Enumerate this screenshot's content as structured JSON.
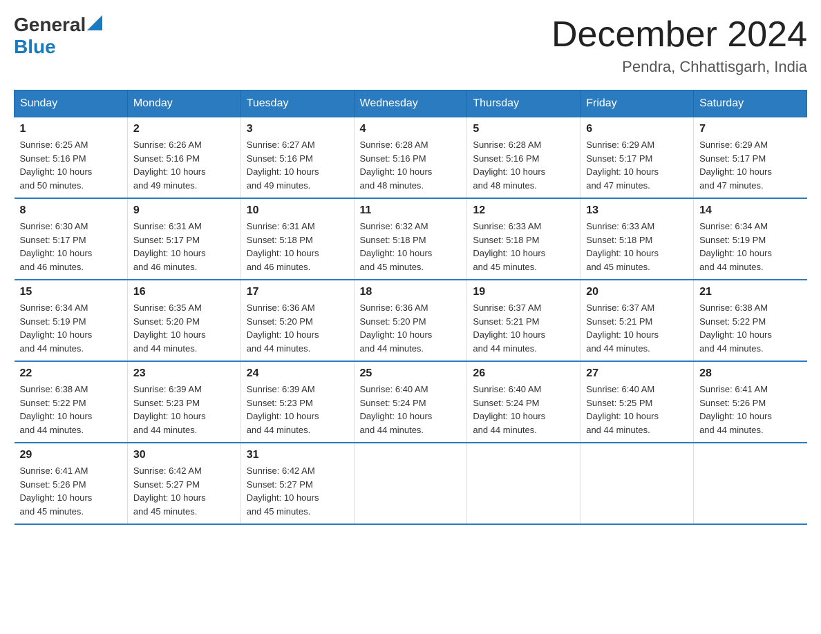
{
  "header": {
    "logo_general": "General",
    "logo_blue": "Blue",
    "month_title": "December 2024",
    "location": "Pendra, Chhattisgarh, India"
  },
  "days_of_week": [
    "Sunday",
    "Monday",
    "Tuesday",
    "Wednesday",
    "Thursday",
    "Friday",
    "Saturday"
  ],
  "weeks": [
    [
      {
        "day": "1",
        "sunrise": "6:25 AM",
        "sunset": "5:16 PM",
        "daylight": "10 hours and 50 minutes."
      },
      {
        "day": "2",
        "sunrise": "6:26 AM",
        "sunset": "5:16 PM",
        "daylight": "10 hours and 49 minutes."
      },
      {
        "day": "3",
        "sunrise": "6:27 AM",
        "sunset": "5:16 PM",
        "daylight": "10 hours and 49 minutes."
      },
      {
        "day": "4",
        "sunrise": "6:28 AM",
        "sunset": "5:16 PM",
        "daylight": "10 hours and 48 minutes."
      },
      {
        "day": "5",
        "sunrise": "6:28 AM",
        "sunset": "5:16 PM",
        "daylight": "10 hours and 48 minutes."
      },
      {
        "day": "6",
        "sunrise": "6:29 AM",
        "sunset": "5:17 PM",
        "daylight": "10 hours and 47 minutes."
      },
      {
        "day": "7",
        "sunrise": "6:29 AM",
        "sunset": "5:17 PM",
        "daylight": "10 hours and 47 minutes."
      }
    ],
    [
      {
        "day": "8",
        "sunrise": "6:30 AM",
        "sunset": "5:17 PM",
        "daylight": "10 hours and 46 minutes."
      },
      {
        "day": "9",
        "sunrise": "6:31 AM",
        "sunset": "5:17 PM",
        "daylight": "10 hours and 46 minutes."
      },
      {
        "day": "10",
        "sunrise": "6:31 AM",
        "sunset": "5:18 PM",
        "daylight": "10 hours and 46 minutes."
      },
      {
        "day": "11",
        "sunrise": "6:32 AM",
        "sunset": "5:18 PM",
        "daylight": "10 hours and 45 minutes."
      },
      {
        "day": "12",
        "sunrise": "6:33 AM",
        "sunset": "5:18 PM",
        "daylight": "10 hours and 45 minutes."
      },
      {
        "day": "13",
        "sunrise": "6:33 AM",
        "sunset": "5:18 PM",
        "daylight": "10 hours and 45 minutes."
      },
      {
        "day": "14",
        "sunrise": "6:34 AM",
        "sunset": "5:19 PM",
        "daylight": "10 hours and 44 minutes."
      }
    ],
    [
      {
        "day": "15",
        "sunrise": "6:34 AM",
        "sunset": "5:19 PM",
        "daylight": "10 hours and 44 minutes."
      },
      {
        "day": "16",
        "sunrise": "6:35 AM",
        "sunset": "5:20 PM",
        "daylight": "10 hours and 44 minutes."
      },
      {
        "day": "17",
        "sunrise": "6:36 AM",
        "sunset": "5:20 PM",
        "daylight": "10 hours and 44 minutes."
      },
      {
        "day": "18",
        "sunrise": "6:36 AM",
        "sunset": "5:20 PM",
        "daylight": "10 hours and 44 minutes."
      },
      {
        "day": "19",
        "sunrise": "6:37 AM",
        "sunset": "5:21 PM",
        "daylight": "10 hours and 44 minutes."
      },
      {
        "day": "20",
        "sunrise": "6:37 AM",
        "sunset": "5:21 PM",
        "daylight": "10 hours and 44 minutes."
      },
      {
        "day": "21",
        "sunrise": "6:38 AM",
        "sunset": "5:22 PM",
        "daylight": "10 hours and 44 minutes."
      }
    ],
    [
      {
        "day": "22",
        "sunrise": "6:38 AM",
        "sunset": "5:22 PM",
        "daylight": "10 hours and 44 minutes."
      },
      {
        "day": "23",
        "sunrise": "6:39 AM",
        "sunset": "5:23 PM",
        "daylight": "10 hours and 44 minutes."
      },
      {
        "day": "24",
        "sunrise": "6:39 AM",
        "sunset": "5:23 PM",
        "daylight": "10 hours and 44 minutes."
      },
      {
        "day": "25",
        "sunrise": "6:40 AM",
        "sunset": "5:24 PM",
        "daylight": "10 hours and 44 minutes."
      },
      {
        "day": "26",
        "sunrise": "6:40 AM",
        "sunset": "5:24 PM",
        "daylight": "10 hours and 44 minutes."
      },
      {
        "day": "27",
        "sunrise": "6:40 AM",
        "sunset": "5:25 PM",
        "daylight": "10 hours and 44 minutes."
      },
      {
        "day": "28",
        "sunrise": "6:41 AM",
        "sunset": "5:26 PM",
        "daylight": "10 hours and 44 minutes."
      }
    ],
    [
      {
        "day": "29",
        "sunrise": "6:41 AM",
        "sunset": "5:26 PM",
        "daylight": "10 hours and 45 minutes."
      },
      {
        "day": "30",
        "sunrise": "6:42 AM",
        "sunset": "5:27 PM",
        "daylight": "10 hours and 45 minutes."
      },
      {
        "day": "31",
        "sunrise": "6:42 AM",
        "sunset": "5:27 PM",
        "daylight": "10 hours and 45 minutes."
      },
      null,
      null,
      null,
      null
    ]
  ],
  "labels": {
    "sunrise_prefix": "Sunrise: ",
    "sunset_prefix": "Sunset: ",
    "daylight_prefix": "Daylight: "
  }
}
